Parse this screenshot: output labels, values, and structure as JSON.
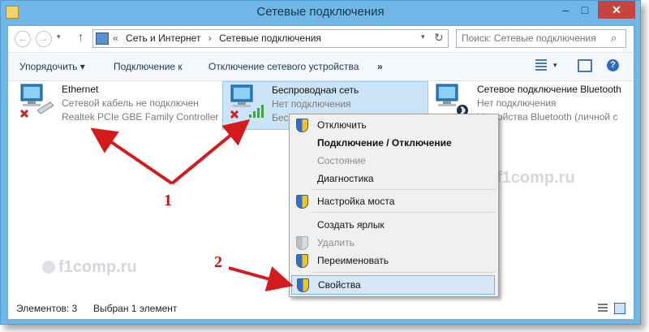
{
  "window": {
    "title": "Сетевые подключения",
    "min_glyph": "–",
    "max_glyph": "□",
    "close_glyph": "✕"
  },
  "nav": {
    "back_glyph": "←",
    "forward_glyph": "→",
    "recent_glyph": "▾",
    "up_glyph": "↑"
  },
  "address": {
    "prefix": "«",
    "crumbs": [
      "Сеть и Интернет",
      "Сетевые подключения"
    ],
    "separator": "›",
    "dropdown_glyph": "▾",
    "refresh_glyph": "↻"
  },
  "search": {
    "placeholder": "Поиск: Сетевые подключения",
    "icon_glyph": "⌕"
  },
  "commands": {
    "organize": "Упорядочить ▾",
    "connect": "Подключение к",
    "disable": "Отключение сетевого устройства",
    "more": "»",
    "view_drop": "▾",
    "help": "?"
  },
  "adapters": [
    {
      "name": "Ethernet",
      "status": "Сетевой кабель не подключен",
      "device": "Realtek PCIe GBE Family Controller",
      "selected": false,
      "kind": "wired-disconnected"
    },
    {
      "name": "Беспроводная сеть",
      "status": "Нет подключения",
      "device": "Беспр",
      "selected": true,
      "kind": "wireless-disconnected"
    },
    {
      "name": "Сетевое подключение Bluetooth",
      "status": "Нет подключения",
      "device": "Устройства Bluetooth (личной с",
      "selected": false,
      "kind": "bluetooth"
    }
  ],
  "context_menu": {
    "items": [
      {
        "label": "Отключить",
        "shield": "color",
        "style": "normal"
      },
      {
        "label": "Подключение / Отключение",
        "shield": "none",
        "style": "bold"
      },
      {
        "label": "Состояние",
        "shield": "none",
        "style": "disabled"
      },
      {
        "label": "Диагностика",
        "shield": "none",
        "style": "normal"
      },
      {
        "label": "Настройка моста",
        "shield": "color",
        "style": "normal"
      },
      {
        "label": "Создать ярлык",
        "shield": "none",
        "style": "normal"
      },
      {
        "label": "Удалить",
        "shield": "grey",
        "style": "disabled"
      },
      {
        "label": "Переименовать",
        "shield": "color",
        "style": "normal"
      },
      {
        "label": "Свойства",
        "shield": "color",
        "style": "highlighted"
      }
    ]
  },
  "statusbar": {
    "count": "Элементов: 3",
    "selected": "Выбран 1 элемент"
  },
  "watermark": {
    "text": "f1comp.ru"
  },
  "annotations": {
    "label1": "1",
    "label2": "2",
    "arrow_color": "#d41a1a"
  },
  "colors": {
    "frame": "#6fb7e6",
    "close": "#c7433e",
    "selection": "#cce4f7"
  }
}
